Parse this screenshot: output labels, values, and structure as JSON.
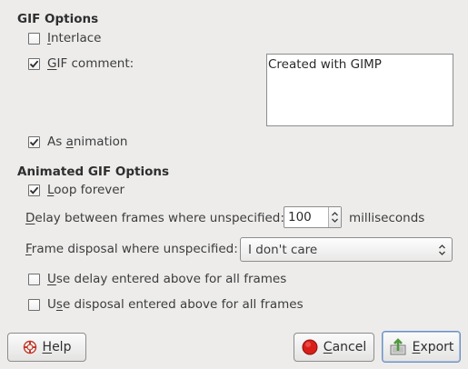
{
  "gif_options": {
    "title": "GIF Options",
    "interlace": {
      "label_mnemonic": "I",
      "label_rest": "nterlace",
      "checked": false
    },
    "gif_comment": {
      "label_mnemonic": "G",
      "label_rest": "IF comment:",
      "checked": true
    },
    "comment_text": "Created with GIMP",
    "as_animation": {
      "label_pre": "As ",
      "label_mnemonic": "a",
      "label_rest": "nimation",
      "checked": true
    }
  },
  "animated_options": {
    "title": "Animated GIF Options",
    "loop_forever": {
      "label_mnemonic": "L",
      "label_rest": "oop forever",
      "checked": true
    },
    "delay": {
      "label_mnemonic": "D",
      "label_rest": "elay between frames where unspecified:",
      "value": "100",
      "unit": "milliseconds"
    },
    "disposal": {
      "label_mnemonic": "F",
      "label_rest": "rame disposal where unspecified:",
      "selected": "I don't care"
    },
    "use_delay_all": {
      "label_mnemonic": "U",
      "label_rest": "se delay entered above for all frames",
      "checked": false
    },
    "use_disposal_all": {
      "label_pre": "U",
      "label_mnemonic": "s",
      "label_rest": "e disposal entered above for all frames",
      "checked": false
    }
  },
  "buttons": {
    "help": {
      "mnemonic": "H",
      "rest": "elp",
      "icon": "help-lifebuoy-icon"
    },
    "cancel": {
      "mnemonic": "C",
      "rest": "ancel",
      "icon": "cancel-red-circle-icon"
    },
    "export": {
      "mnemonic": "E",
      "rest": "xport",
      "icon": "export-arrow-icon"
    }
  },
  "colors": {
    "background": "#edeceb",
    "cancel_red": "#d91e18",
    "export_green": "#4e9a3c"
  }
}
